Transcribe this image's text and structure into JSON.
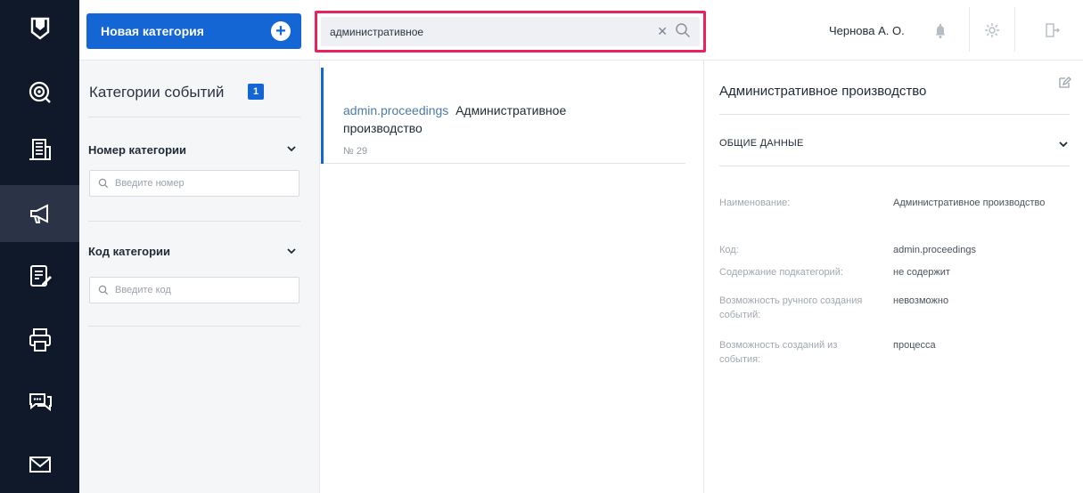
{
  "rail": {
    "items": [
      {
        "icon": "logo-shield-icon"
      },
      {
        "icon": "radar-icon"
      },
      {
        "icon": "building-icon"
      },
      {
        "icon": "megaphone-icon"
      },
      {
        "icon": "edit-document-icon"
      },
      {
        "icon": "printer-icon"
      },
      {
        "icon": "chat-icon"
      },
      {
        "icon": "mail-icon"
      }
    ]
  },
  "topbar": {
    "new_category_label": "Новая категория",
    "search_value": "административное",
    "user_name": "Чернова А. О."
  },
  "filters": {
    "title": "Категории событий",
    "count": "1",
    "number_label": "Номер категории",
    "number_placeholder": "Введите номер",
    "code_label": "Код категории",
    "code_placeholder": "Введите код"
  },
  "results": [
    {
      "code": "admin.proceedings",
      "name": "Административное производство",
      "number": "№ 29"
    }
  ],
  "detail": {
    "title": "Административное производство",
    "section": "ОБЩИЕ ДАННЫЕ",
    "fields": [
      {
        "key": "Наименование:",
        "value": "Административное производство"
      },
      {
        "key": "Код:",
        "value": "admin.proceedings"
      },
      {
        "key": "Содержание подкатегорий:",
        "value": "не содержит"
      },
      {
        "key": "Возможность ручного создания событий:",
        "value": "невозможно"
      },
      {
        "key": "Возможность созданий из события:",
        "value": "процесса"
      }
    ]
  },
  "colors": {
    "accent": "#1466d4",
    "highlight": "#e8215f",
    "rail": "#10192a"
  }
}
